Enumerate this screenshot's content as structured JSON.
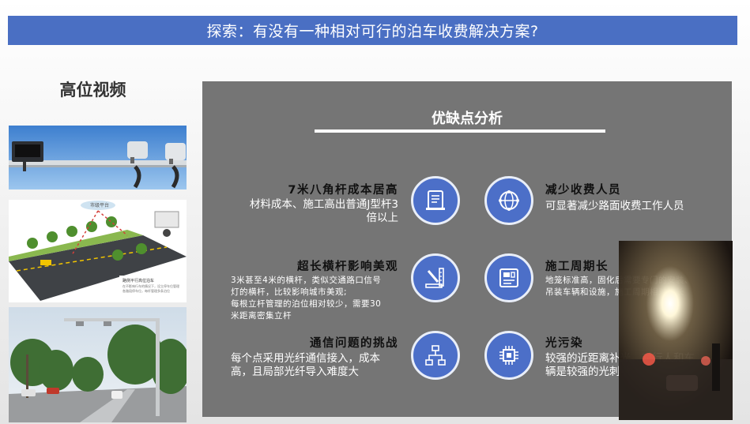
{
  "header": {
    "title": "探索：有没有一种相对可行的泊车收费解决方案?"
  },
  "sidebar": {
    "title": "高位视频",
    "diagram": {
      "platform_label": "市级平台",
      "caption_title": "路侧平行高位泊车",
      "caption_lines": [
        "在不影响行车的情况下，设立停车位管理",
        "各路段停车位，每杆管理多条泊位"
      ]
    }
  },
  "panel": {
    "title": "优缺点分析",
    "items": [
      {
        "title": "7米八角杆成本居高",
        "desc": [
          "材料成本、施工高出普通J型杆3",
          "倍以上"
        ],
        "icon": "document-icon"
      },
      {
        "title": "减少收费人员",
        "desc": [
          "可显著减少路面收费工作人员"
        ],
        "icon": "globe-network-icon"
      },
      {
        "title": "超长横杆影响美观",
        "desc": [
          "3米甚至4米的横杆，类似交通路口信号",
          "灯的横杆，比较影响城市美观;",
          "每根立杆管理的泊位相对较少，需要30",
          "米距离密集立杆"
        ],
        "icon": "ruler-tools-icon"
      },
      {
        "title": "施工周期长",
        "desc": [
          "地笼标准高，固化后需要专门的安装、",
          "吊装车辆和设施，施工周期相对较长"
        ],
        "icon": "construction-card-icon"
      },
      {
        "title": "通信问题的挑战",
        "desc": [
          "每个点采用光纤通信接入，成本",
          "高，且局部光纤导入难度大"
        ],
        "icon": "network-topology-icon"
      },
      {
        "title": "光污染",
        "desc": [
          "较强的近距离补光，对行人和车",
          "辆是较强的光刺激"
        ],
        "icon": "chip-icon"
      }
    ]
  },
  "colors": {
    "title_bar": "#4a6fc3",
    "panel_bg": "#757575",
    "icon_bg": "#4c6fc8"
  }
}
